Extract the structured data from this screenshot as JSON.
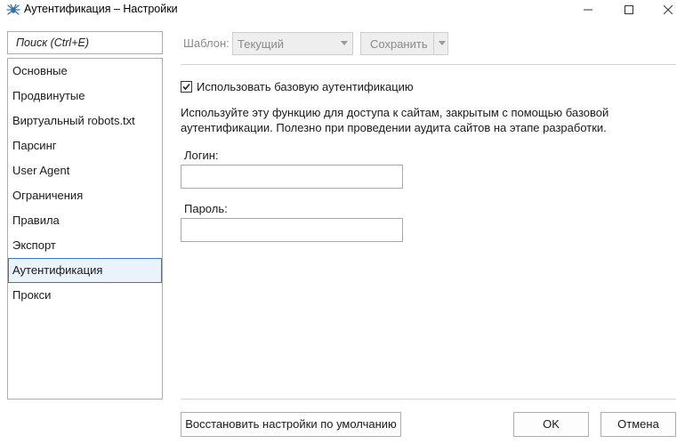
{
  "window": {
    "title": "Аутентификация – Настройки",
    "app_icon": "spider-icon"
  },
  "search": {
    "placeholder": "Поиск (Ctrl+E)"
  },
  "sidebar": {
    "items": [
      {
        "label": "Основные"
      },
      {
        "label": "Продвинутые"
      },
      {
        "label": "Виртуальный robots.txt"
      },
      {
        "label": "Парсинг"
      },
      {
        "label": "User Agent"
      },
      {
        "label": "Ограничения"
      },
      {
        "label": "Правила"
      },
      {
        "label": "Экспорт"
      },
      {
        "label": "Аутентификация",
        "selected": true
      },
      {
        "label": "Прокси"
      }
    ]
  },
  "template": {
    "label": "Шаблон:",
    "selected": "Текущий",
    "save_label": "Сохранить"
  },
  "auth": {
    "checkbox_label": "Использовать базовую аутентификацию",
    "checked": true,
    "description": "Используйте эту функцию для доступа к сайтам, закрытым с помощью базовой аутентификации. Полезно при проведении аудита сайтов на этапе разработки.",
    "login_label": "Логин:",
    "login_value": "",
    "password_label": "Пароль:",
    "password_value": ""
  },
  "footer": {
    "restore_label": "Восстановить настройки по умолчанию",
    "ok_label": "OK",
    "cancel_label": "Отмена"
  },
  "colors": {
    "selection_border": "#3b78c2",
    "selection_bg": "#eaf2fb"
  }
}
